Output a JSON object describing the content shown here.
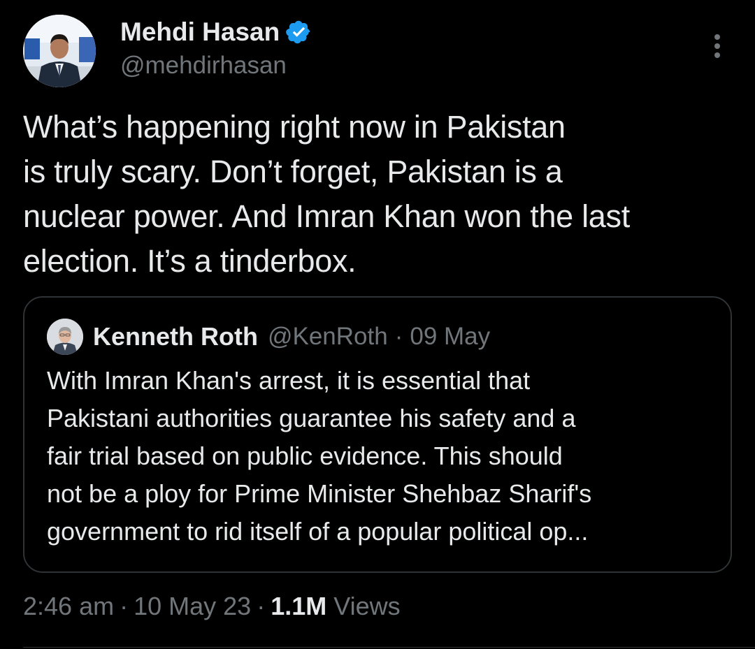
{
  "colors": {
    "background": "#000000",
    "primary_text": "#e7e9ea",
    "secondary_text": "#71767b",
    "border": "#2f3336",
    "verified_badge": "#1d9bf0"
  },
  "author": {
    "name": "Mehdi Hasan",
    "handle": "@mehdirhasan",
    "verified_icon": "verified-badge-icon",
    "avatar_icon": "avatar-photo"
  },
  "more_menu_icon": "more-vertical-icon",
  "tweet_text_lines": [
    "What’s happening right now in Pakistan",
    "is truly scary. Don’t forget, Pakistan is a",
    "nuclear power. And Imran Khan won the last",
    "election. It’s a tinderbox."
  ],
  "quoted_tweet": {
    "name": "Kenneth Roth",
    "handle": "@KenRoth",
    "separator": "·",
    "date": "09 May",
    "text_lines": [
      "With Imran Khan's arrest, it is essential that",
      "Pakistani authorities guarantee his safety and a",
      "fair trial based on public evidence. This should",
      "not be a ploy for Prime Minister Shehbaz Sharif's",
      "government to rid itself of a popular political op..."
    ]
  },
  "meta": {
    "time": "2:46 am",
    "separator": "·",
    "date": "10 May 23",
    "views_count": "1.1M",
    "views_label": "Views"
  }
}
